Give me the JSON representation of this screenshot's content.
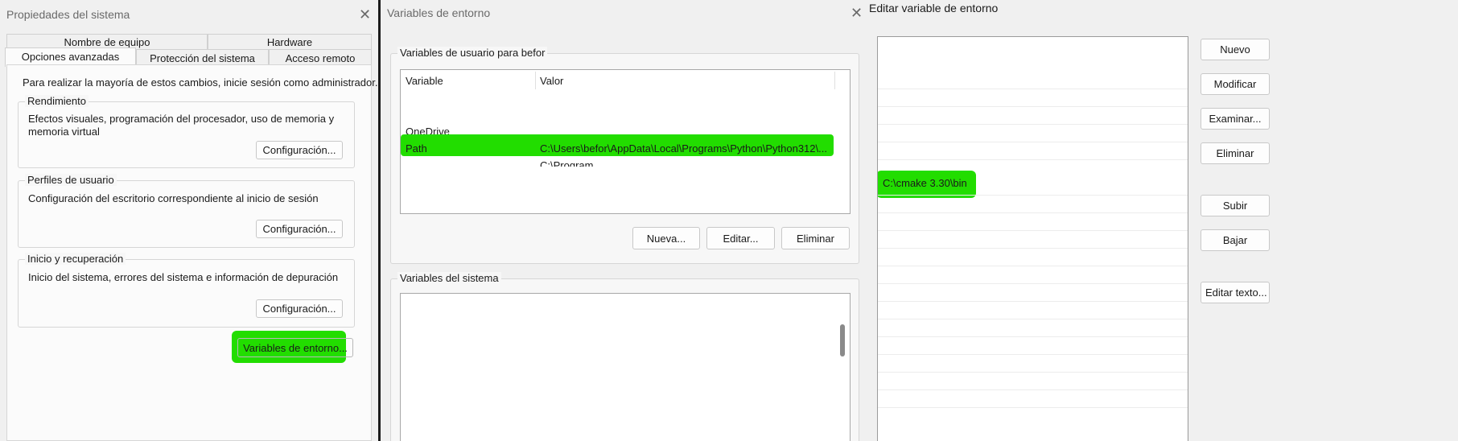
{
  "win1": {
    "title": "Propiedades del sistema",
    "tabs_row1": [
      "Nombre de equipo",
      "Hardware"
    ],
    "tabs_row2": [
      "Opciones avanzadas",
      "Protección del sistema",
      "Acceso remoto"
    ],
    "admin_notice": "Para realizar la mayoría de estos cambios, inicie sesión como administrador.",
    "groups": [
      {
        "label": "Rendimiento",
        "text": "Efectos visuales, programación del procesador, uso de memoria y memoria virtual",
        "button": "Configuración..."
      },
      {
        "label": "Perfiles de usuario",
        "text": "Configuración del escritorio correspondiente al inicio de sesión",
        "button": "Configuración..."
      },
      {
        "label": "Inicio y recuperación",
        "text": "Inicio del sistema, errores del sistema e información de depuración",
        "button": "Configuración..."
      }
    ],
    "env_button": "Variables de entorno..."
  },
  "win2": {
    "title": "Variables de entorno",
    "user_group_label": "Variables de usuario para befor",
    "columns": [
      "Variable",
      "Valor"
    ],
    "user_rows": [
      {
        "variable": "OneDrive",
        "value": ""
      },
      {
        "variable": "Path",
        "value": "C:\\Users\\befor\\AppData\\Local\\Programs\\Python\\Python312\\..."
      },
      {
        "variable": "",
        "value": "C:\\Program..."
      }
    ],
    "user_buttons": [
      "Nueva...",
      "Editar...",
      "Eliminar"
    ],
    "system_group_label": "Variables del sistema"
  },
  "win3": {
    "title": "Editar variable de entorno",
    "entries": [
      "C:\\cmake 3.30\\bin"
    ],
    "buttons": [
      "Nuevo",
      "Modificar",
      "Examinar...",
      "Eliminar",
      "Subir",
      "Bajar",
      "Editar texto..."
    ]
  },
  "colors": {
    "highlight": "#22dd00",
    "window_bg": "#f0f0f0",
    "list_bg": "#ffffff"
  }
}
